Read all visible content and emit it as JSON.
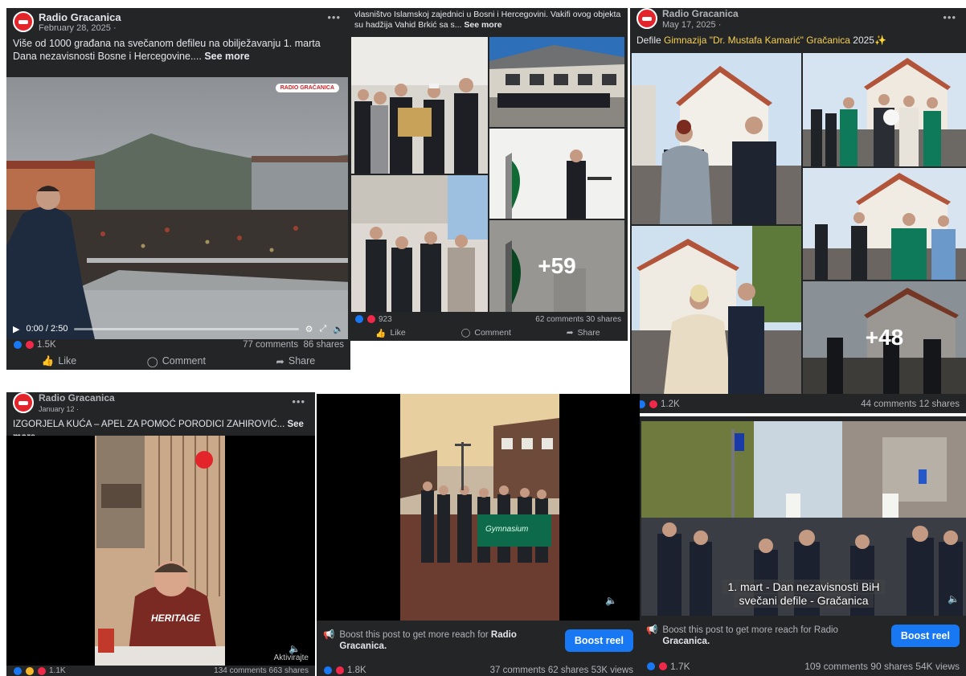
{
  "posts": [
    {
      "page_name": "Radio Gracanica",
      "date": "February 28, 2025 ·",
      "text": "Više od 1000 građana na svečanom defileu na obilježavanju 1. marta Dana nezavisnosti Bosne i Hercegovine....",
      "see_more": "See more",
      "watermark": "RADIO GRAČANICA",
      "video_time": "0:00 / 2:50",
      "reactions": "1.5K",
      "comments": "77 comments",
      "shares": "86 shares",
      "like": "Like",
      "comment": "Comment",
      "share": "Share"
    },
    {
      "text_line1": "vlasništvo Islamskoj zajednici u Bosni i Hercegovini. Vakifi ovog objekta",
      "text_line2": "su hadžija Vahid Brkić sa s...",
      "see_more": "See more",
      "more_photos": "+59",
      "reactions": "923",
      "comments_shares": "62 comments  30 shares",
      "like": "Like",
      "comment": "Comment",
      "share": "Share"
    },
    {
      "page_name": "Radio Gracanica",
      "date": "May 17, 2025 ·",
      "text_prefix": "Defile ",
      "text_link": "Gimnazija \"Dr. Mustafa Kamarić\" Gračanica",
      "text_suffix": " 2025✨",
      "more_photos": "+48",
      "reactions": "1.2K",
      "comments_shares": "44 comments  12 shares"
    },
    {
      "page_name": "Radio Gracanica",
      "date": "January 12 ·",
      "text": "IZGORJELA KUĆA – APEL ZA POMOĆ PORODICI ZAHIROVIĆ...",
      "see_more": "See more",
      "shirt_text": "HERITAGE",
      "overlay_text": "Aktivirajte",
      "reactions": "1.1K",
      "comments_shares": "134 comments  663 shares"
    },
    {
      "boost_text": "Boost this post to get more reach for",
      "boost_page": "Radio Gracanica.",
      "boost_button": "Boost reel",
      "banner_text": "Gymnasium",
      "reactions": "1.8K",
      "stats": "37 comments  62 shares  53K views"
    },
    {
      "caption_line1": "1. mart - Dan nezavisnosti BiH",
      "caption_line2": "svečani defile - Gračanica",
      "boost_text": "Boost this post to get more reach for Radio",
      "boost_page": "Gracanica.",
      "boost_button": "Boost reel",
      "reactions": "1.7K",
      "stats": "109 comments  90 shares  54K views"
    }
  ],
  "colors": {
    "card_bg": "#242526",
    "text_primary": "#e4e6eb",
    "text_secondary": "#b0b3b8",
    "accent_blue": "#1877f2",
    "link_yellow": "#f7d154",
    "brand_red": "#e4242b"
  }
}
